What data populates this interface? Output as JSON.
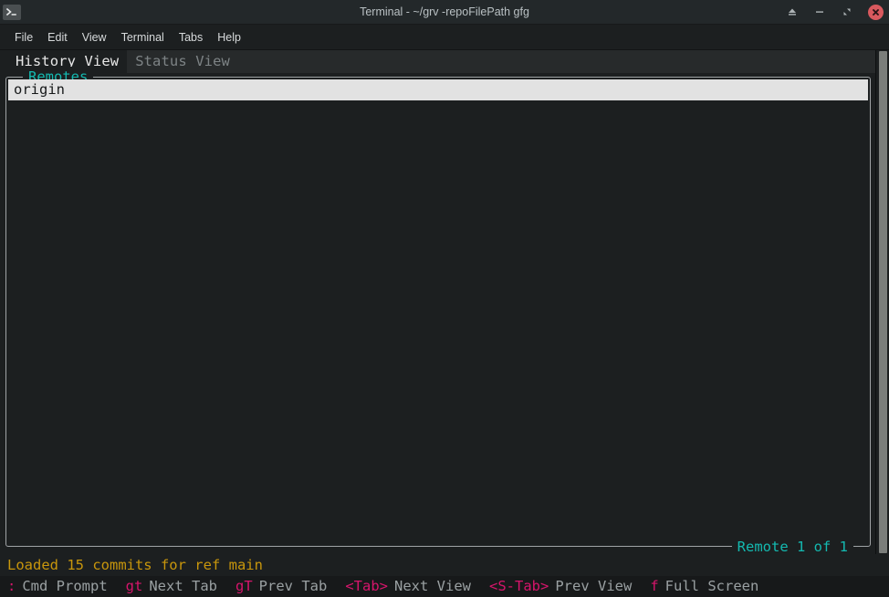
{
  "window": {
    "title": "Terminal - ~/grv -repoFilePath gfg",
    "icon": "terminal-prompt-icon",
    "controls": [
      {
        "name": "eject-button",
        "glyph": "eject"
      },
      {
        "name": "minimize-button",
        "glyph": "minimize"
      },
      {
        "name": "maximize-button",
        "glyph": "maximize"
      },
      {
        "name": "close-button",
        "glyph": "close"
      }
    ]
  },
  "menubar": {
    "items": [
      {
        "label": "File"
      },
      {
        "label": "Edit"
      },
      {
        "label": "View"
      },
      {
        "label": "Terminal"
      },
      {
        "label": "Tabs"
      },
      {
        "label": "Help"
      }
    ]
  },
  "tabs": [
    {
      "label": "History View",
      "active": true
    },
    {
      "label": "Status View",
      "active": false
    }
  ],
  "panel": {
    "title": "Remotes",
    "footer": "Remote 1 of 1",
    "rows": [
      {
        "label": "origin",
        "selected": true
      }
    ]
  },
  "status": {
    "message": "Loaded 15 commits for ref main"
  },
  "helpbar": {
    "items": [
      {
        "key": ":",
        "label": "Cmd Prompt"
      },
      {
        "key": "gt",
        "label": "Next Tab"
      },
      {
        "key": "gT",
        "label": "Prev Tab"
      },
      {
        "key": "<Tab>",
        "label": "Next View"
      },
      {
        "key": "<S-Tab>",
        "label": "Prev View"
      },
      {
        "key": "f",
        "label": "Full Screen"
      }
    ]
  },
  "colors": {
    "titlebar_bg": "#23282a",
    "terminal_bg": "#1c1f20",
    "accent_cyan": "#14b9b0",
    "status_yellow": "#c8960c",
    "key_pink": "#d6156b",
    "close_red": "#d9595e",
    "selected_row_bg": "#e2e2e2",
    "scrollbar_thumb": "#7b7e7b"
  }
}
